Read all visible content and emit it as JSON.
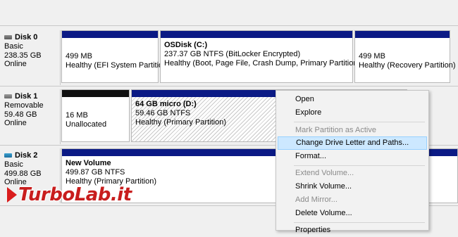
{
  "disks": [
    {
      "name": "Disk 0",
      "type": "Basic",
      "size": "238.35 GB",
      "status": "Online",
      "icon": "hdd-icon"
    },
    {
      "name": "Disk 1",
      "type": "Removable",
      "size": "59.48 GB",
      "status": "Online",
      "icon": "usb-drive-icon"
    },
    {
      "name": "Disk 2",
      "type": "Basic",
      "size": "499.88 GB",
      "status": "Online",
      "icon": "disk-icon"
    }
  ],
  "partitions": {
    "d0p1": {
      "size": "499 MB",
      "desc": "Healthy (EFI System Partition"
    },
    "d0p2": {
      "title": "OSDisk (C:)",
      "size": "237.37 GB NTFS (BitLocker Encrypted)",
      "desc": "Healthy (Boot, Page File, Crash Dump, Primary Partition)"
    },
    "d0p3": {
      "size": "499 MB",
      "desc": "Healthy (Recovery Partition)"
    },
    "d1p1": {
      "size": "16 MB",
      "desc": "Unallocated"
    },
    "d1p2": {
      "title": "64 GB micro  (D:)",
      "size": "59.46 GB NTFS",
      "desc": "Healthy (Primary Partition)"
    },
    "d2p1": {
      "title": "New Volume",
      "size": "499.87 GB NTFS",
      "desc": "Healthy (Primary Partition)"
    }
  },
  "menu": [
    {
      "label": "Open",
      "enabled": true
    },
    {
      "label": "Explore",
      "enabled": true
    },
    {
      "label": "Mark Partition as Active",
      "enabled": false
    },
    {
      "label": "Change Drive Letter and Paths...",
      "enabled": true,
      "highlighted": true
    },
    {
      "label": "Format...",
      "enabled": true
    },
    {
      "label": "Extend Volume...",
      "enabled": false
    },
    {
      "label": "Shrink Volume...",
      "enabled": true
    },
    {
      "label": "Add Mirror...",
      "enabled": false
    },
    {
      "label": "Delete Volume...",
      "enabled": true
    },
    {
      "label": "Properties",
      "enabled": true
    }
  ],
  "watermark": "TurboLab.it",
  "colors": {
    "primary_bar": "#0b1a85",
    "unallocated_bar": "#101010",
    "highlight": "#cce8ff"
  }
}
